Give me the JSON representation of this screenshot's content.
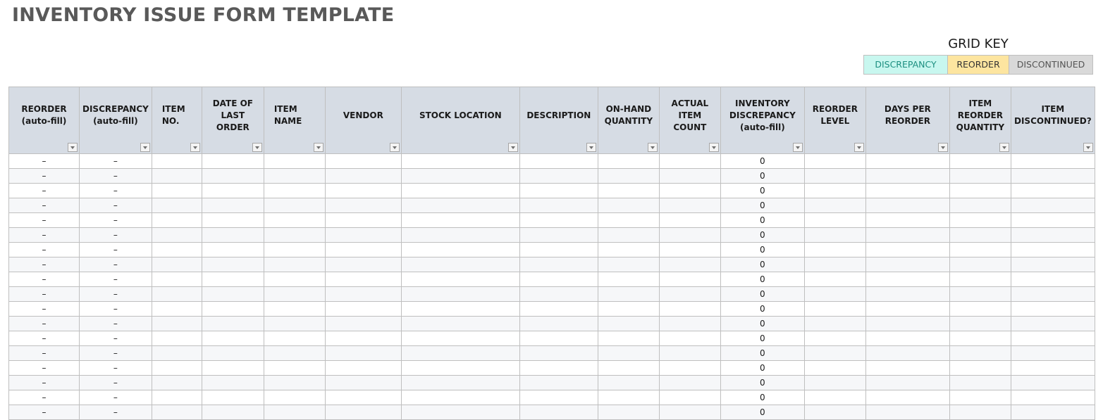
{
  "title": "INVENTORY ISSUE FORM TEMPLATE",
  "grid_key": {
    "title": "GRID KEY",
    "items": [
      {
        "label": "DISCREPANCY",
        "color": "#c8f7ef",
        "text_color": "#1c8f80"
      },
      {
        "label": "REORDER",
        "color": "#fde5a0",
        "text_color": "#333333"
      },
      {
        "label": "DISCONTINUED",
        "color": "#d9d9d9",
        "text_color": "#555555"
      }
    ]
  },
  "table": {
    "columns": [
      {
        "key": "reorder",
        "label": "REORDER\n(auto-fill)"
      },
      {
        "key": "discrepancy",
        "label": "DISCREPANCY\n(auto-fill)"
      },
      {
        "key": "item_no",
        "label": "ITEM\nNO."
      },
      {
        "key": "date_last_order",
        "label": "DATE OF\nLAST ORDER"
      },
      {
        "key": "item_name",
        "label": "ITEM\nNAME"
      },
      {
        "key": "vendor",
        "label": "VENDOR"
      },
      {
        "key": "stock_location",
        "label": "STOCK LOCATION"
      },
      {
        "key": "description",
        "label": "DESCRIPTION"
      },
      {
        "key": "on_hand_quantity",
        "label": "ON-HAND\nQUANTITY"
      },
      {
        "key": "actual_item_count",
        "label": "ACTUAL\nITEM COUNT"
      },
      {
        "key": "inventory_discrepancy",
        "label": "INVENTORY\nDISCREPANCY\n(auto-fill)"
      },
      {
        "key": "reorder_level",
        "label": "REORDER\nLEVEL"
      },
      {
        "key": "days_per_reorder",
        "label": "DAYS PER\nREORDER"
      },
      {
        "key": "item_reorder_quantity",
        "label": "ITEM\nREORDER\nQUANTITY"
      },
      {
        "key": "item_discontinued",
        "label": "ITEM\nDISCONTINUED?"
      }
    ],
    "rows": [
      [
        "–",
        "–",
        "",
        "",
        "",
        "",
        "",
        "",
        "",
        "",
        "0",
        "",
        "",
        "",
        ""
      ],
      [
        "–",
        "–",
        "",
        "",
        "",
        "",
        "",
        "",
        "",
        "",
        "0",
        "",
        "",
        "",
        ""
      ],
      [
        "–",
        "–",
        "",
        "",
        "",
        "",
        "",
        "",
        "",
        "",
        "0",
        "",
        "",
        "",
        ""
      ],
      [
        "–",
        "–",
        "",
        "",
        "",
        "",
        "",
        "",
        "",
        "",
        "0",
        "",
        "",
        "",
        ""
      ],
      [
        "–",
        "–",
        "",
        "",
        "",
        "",
        "",
        "",
        "",
        "",
        "0",
        "",
        "",
        "",
        ""
      ],
      [
        "–",
        "–",
        "",
        "",
        "",
        "",
        "",
        "",
        "",
        "",
        "0",
        "",
        "",
        "",
        ""
      ],
      [
        "–",
        "–",
        "",
        "",
        "",
        "",
        "",
        "",
        "",
        "",
        "0",
        "",
        "",
        "",
        ""
      ],
      [
        "–",
        "–",
        "",
        "",
        "",
        "",
        "",
        "",
        "",
        "",
        "0",
        "",
        "",
        "",
        ""
      ],
      [
        "–",
        "–",
        "",
        "",
        "",
        "",
        "",
        "",
        "",
        "",
        "0",
        "",
        "",
        "",
        ""
      ],
      [
        "–",
        "–",
        "",
        "",
        "",
        "",
        "",
        "",
        "",
        "",
        "0",
        "",
        "",
        "",
        ""
      ],
      [
        "–",
        "–",
        "",
        "",
        "",
        "",
        "",
        "",
        "",
        "",
        "0",
        "",
        "",
        "",
        ""
      ],
      [
        "–",
        "–",
        "",
        "",
        "",
        "",
        "",
        "",
        "",
        "",
        "0",
        "",
        "",
        "",
        ""
      ],
      [
        "–",
        "–",
        "",
        "",
        "",
        "",
        "",
        "",
        "",
        "",
        "0",
        "",
        "",
        "",
        ""
      ],
      [
        "–",
        "–",
        "",
        "",
        "",
        "",
        "",
        "",
        "",
        "",
        "0",
        "",
        "",
        "",
        ""
      ],
      [
        "–",
        "–",
        "",
        "",
        "",
        "",
        "",
        "",
        "",
        "",
        "0",
        "",
        "",
        "",
        ""
      ],
      [
        "–",
        "–",
        "",
        "",
        "",
        "",
        "",
        "",
        "",
        "",
        "0",
        "",
        "",
        "",
        ""
      ],
      [
        "–",
        "–",
        "",
        "",
        "",
        "",
        "",
        "",
        "",
        "",
        "0",
        "",
        "",
        "",
        ""
      ],
      [
        "–",
        "–",
        "",
        "",
        "",
        "",
        "",
        "",
        "",
        "",
        "0",
        "",
        "",
        "",
        ""
      ]
    ]
  }
}
